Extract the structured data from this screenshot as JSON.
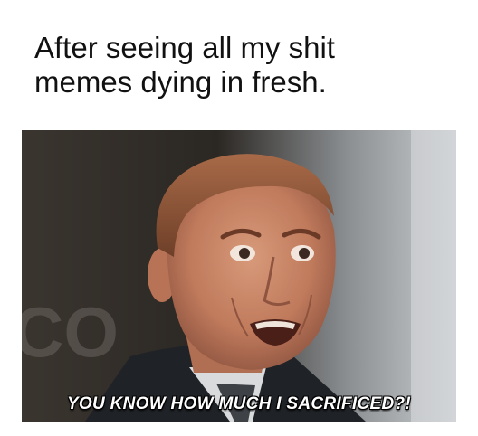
{
  "caption": {
    "line1": "After seeing all my shit",
    "line2": "memes dying in fresh."
  },
  "meme": {
    "subtitle": "YOU KNOW HOW MUCH I SACRIFICED?!",
    "background_text": "CO"
  }
}
